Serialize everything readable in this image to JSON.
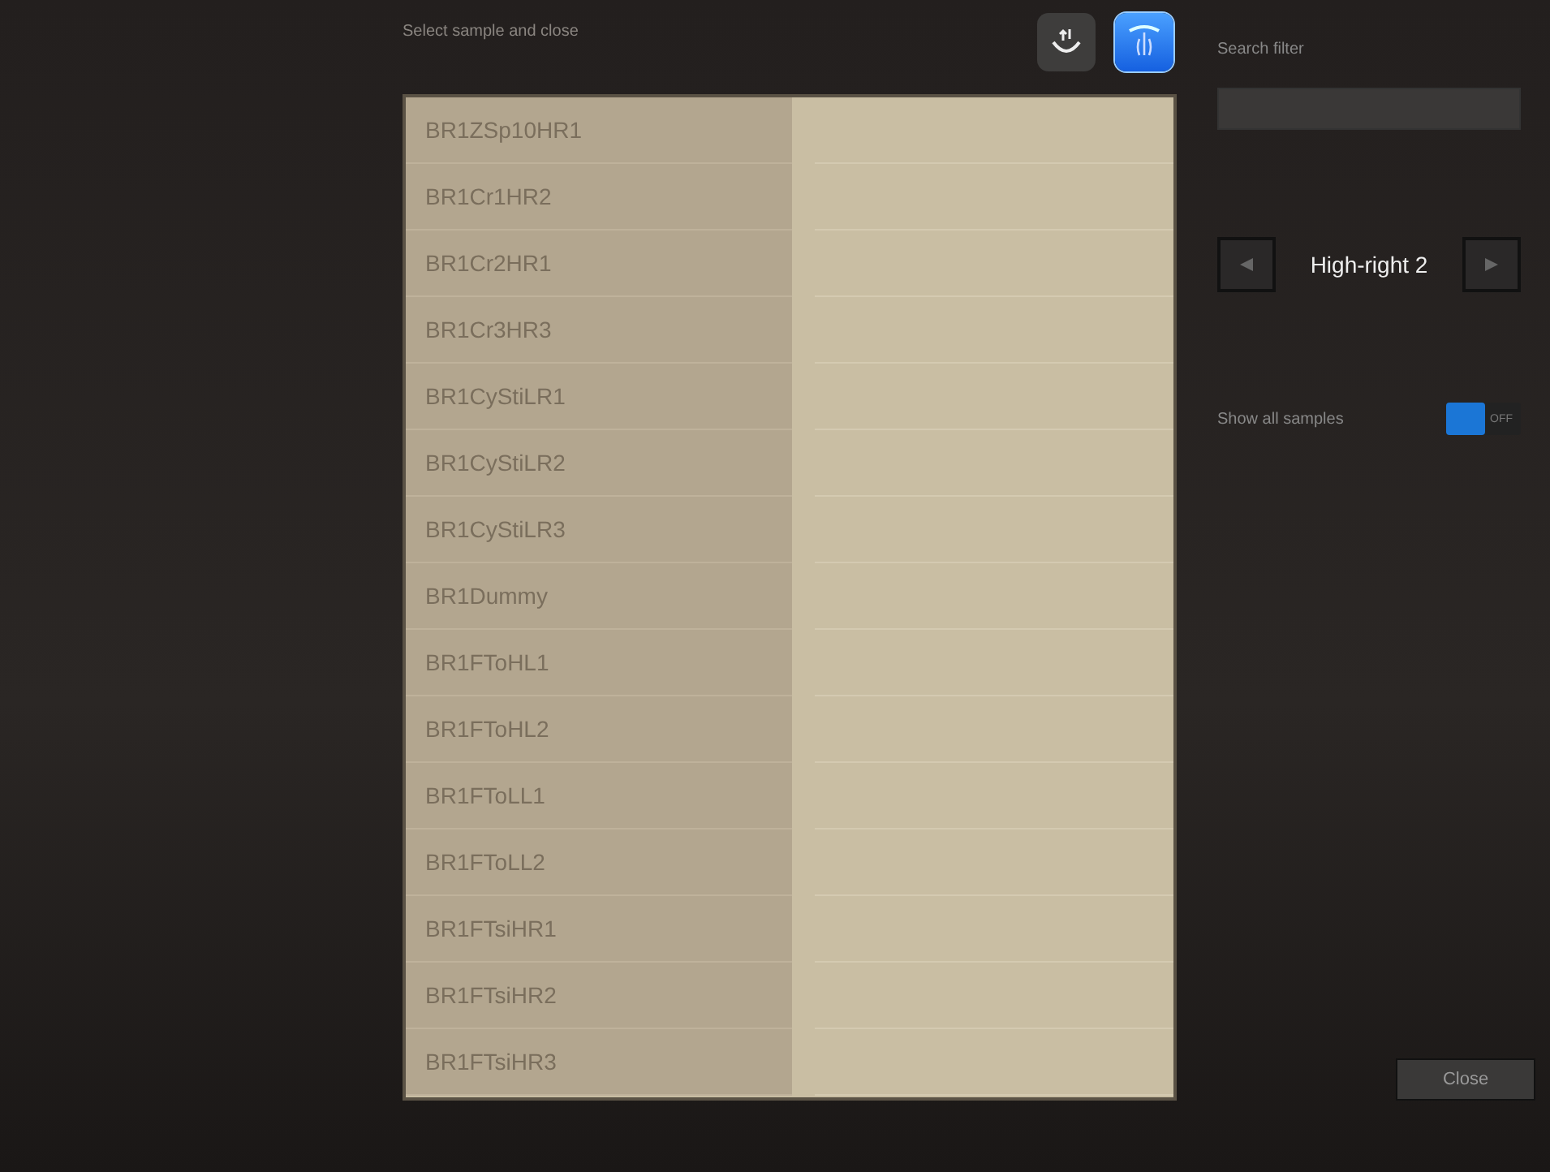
{
  "header": {
    "title": "Select sample and close"
  },
  "toolbar": [
    {
      "kind": "plain",
      "selected": false
    },
    {
      "kind": "highlight",
      "selected": true
    }
  ],
  "samples": [
    {
      "name": "BR1ZSp10HR1",
      "selected": false
    },
    {
      "name": "BR1Cr1HR2",
      "selected": false
    },
    {
      "name": "BR1Cr2HR1",
      "selected": false
    },
    {
      "name": "BR1Cr3HR3",
      "selected": false
    },
    {
      "name": "BR1CyStiLR1",
      "selected": false
    },
    {
      "name": "BR1CyStiLR2",
      "selected": false
    },
    {
      "name": "BR1CyStiLR3",
      "selected": false
    },
    {
      "name": "BR1Dummy",
      "selected": false
    },
    {
      "name": "BR1FToHL1",
      "selected": false
    },
    {
      "name": "BR1FToHL2",
      "selected": false
    },
    {
      "name": "BR1FToLL1",
      "selected": false
    },
    {
      "name": "BR1FToLL2",
      "selected": false
    },
    {
      "name": "BR1FTsiHR1",
      "selected": false
    },
    {
      "name": "BR1FTsiHR2",
      "selected": false
    },
    {
      "name": "BR1FTsiHR3",
      "selected": false
    }
  ],
  "search": {
    "label": "Search filter"
  },
  "position": {
    "value": "High-right 2"
  },
  "show_all": {
    "label": "Show all samples",
    "on": false,
    "state_label": "OFF"
  },
  "close_button": "Close"
}
